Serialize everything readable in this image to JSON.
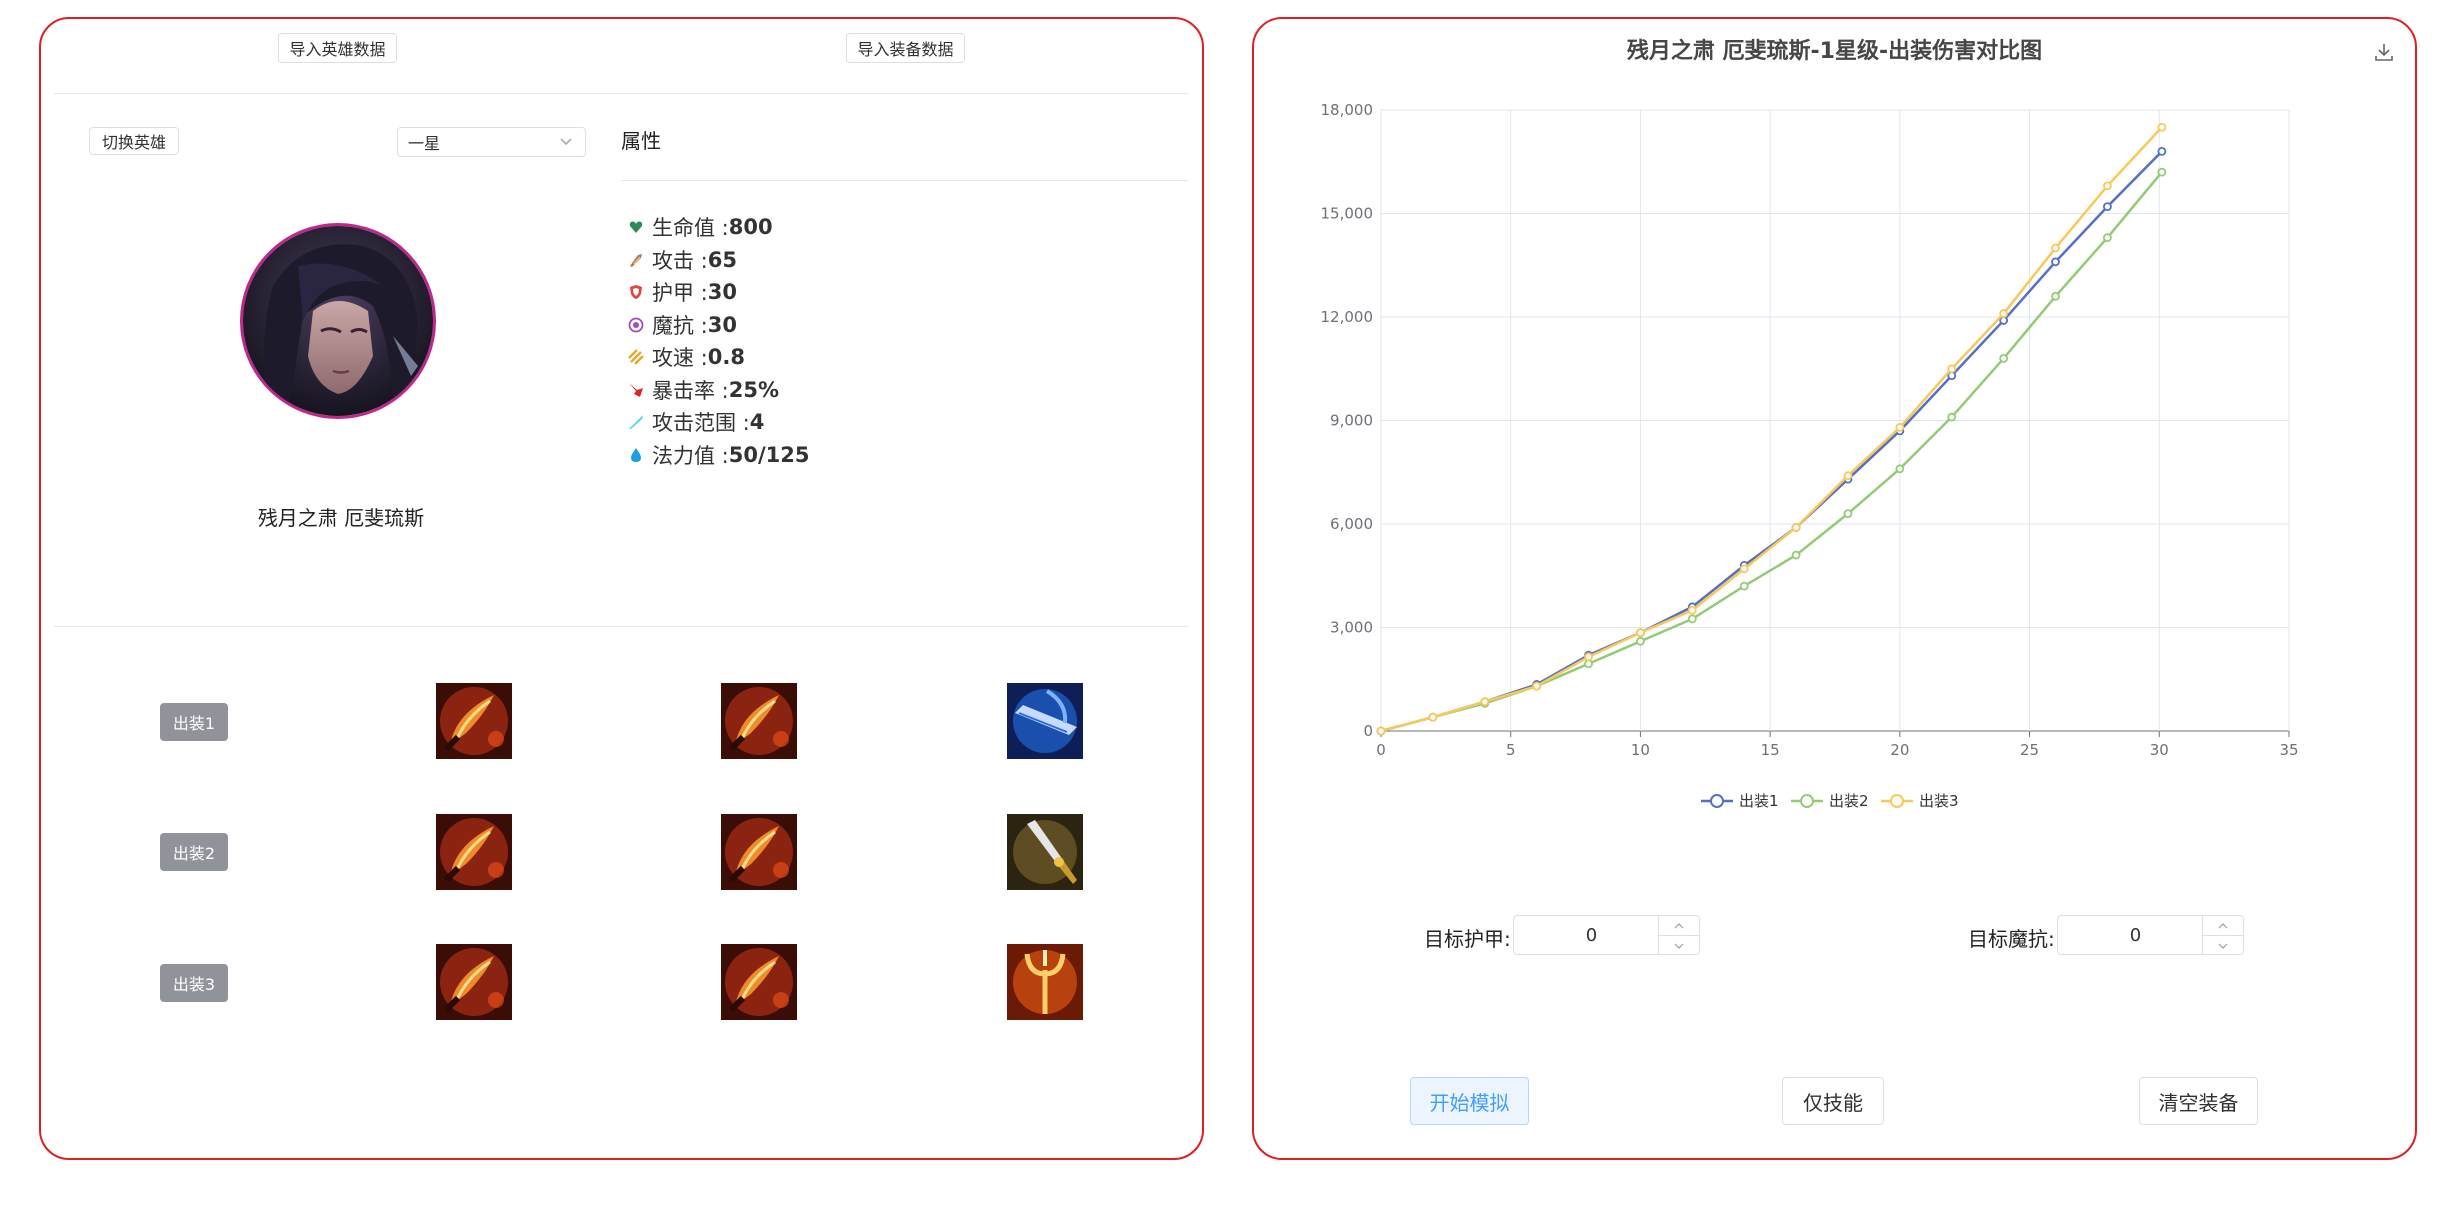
{
  "left": {
    "import_hero_label": "导入英雄数据",
    "import_item_label": "导入装备数据",
    "switch_hero_label": "切换英雄",
    "star_select_value": "一星",
    "hero_name": "残月之肃 厄斐琉斯",
    "attributes_title": "属性",
    "attributes": [
      {
        "label": "生命值 : ",
        "value": "800",
        "icon": "heart-icon",
        "color": "#2e8b57"
      },
      {
        "label": "攻击 : ",
        "value": "65",
        "icon": "attack-icon",
        "color": "#b8764a"
      },
      {
        "label": "护甲 : ",
        "value": "30",
        "icon": "armor-icon",
        "color": "#e0473a"
      },
      {
        "label": "魔抗 : ",
        "value": "30",
        "icon": "magic-resist-icon",
        "color": "#a04bc0"
      },
      {
        "label": "攻速 : ",
        "value": "0.8",
        "icon": "attack-speed-icon",
        "color": "#e8a92c"
      },
      {
        "label": "暴击率 : ",
        "value": "25%",
        "icon": "crit-icon",
        "color": "#d9262c"
      },
      {
        "label": "攻击范围 : ",
        "value": "4",
        "icon": "range-icon",
        "color": "#4fd6e6"
      },
      {
        "label": "法力值 : ",
        "value": "50/125",
        "icon": "mana-icon",
        "color": "#1a9fe0"
      }
    ],
    "builds": [
      {
        "label": "出装1",
        "items": [
          "sword-item-icon",
          "sword-item-icon",
          "blue-blade-item-icon"
        ]
      },
      {
        "label": "出装2",
        "items": [
          "sword-item-icon",
          "sword-item-icon",
          "dagger-item-icon"
        ]
      },
      {
        "label": "出装3",
        "items": [
          "sword-item-icon",
          "sword-item-icon",
          "trident-item-icon"
        ]
      }
    ]
  },
  "right": {
    "chart_title": "残月之肃 厄斐琉斯-1星级-出装伤害对比图",
    "armor_label": "目标护甲:",
    "armor_value": "0",
    "mr_label": "目标魔抗:",
    "mr_value": "0",
    "start_label": "开始模拟",
    "skill_only_label": "仅技能",
    "clear_label": "清空装备"
  },
  "chart_data": {
    "type": "line",
    "title": "残月之肃 厄斐琉斯-1星级-出装伤害对比图",
    "xlabel": "",
    "ylabel": "",
    "xlim": [
      0,
      35
    ],
    "ylim": [
      0,
      18000
    ],
    "xticks": [
      0,
      5,
      10,
      15,
      20,
      25,
      30,
      35
    ],
    "yticks": [
      0,
      3000,
      6000,
      9000,
      12000,
      15000,
      18000
    ],
    "ytick_labels": [
      "0",
      "3,000",
      "6,000",
      "9,000",
      "12,000",
      "15,000",
      "18,000"
    ],
    "grid": true,
    "legend": "bottom-center",
    "series": [
      {
        "name": "出装1",
        "color": "#5470c6",
        "x": [
          0,
          2,
          4,
          6,
          8,
          10,
          12,
          14,
          16,
          18,
          20,
          22,
          24,
          26,
          28,
          30.1
        ],
        "y": [
          0,
          400,
          850,
          1350,
          2200,
          2850,
          3600,
          4800,
          5900,
          7300,
          8700,
          10300,
          11900,
          13600,
          15200,
          16800
        ]
      },
      {
        "name": "出装2",
        "color": "#91cc75",
        "x": [
          0,
          2,
          4,
          6,
          8,
          10,
          12,
          14,
          16,
          18,
          20,
          22,
          24,
          26,
          28,
          30.1
        ],
        "y": [
          0,
          400,
          800,
          1300,
          1950,
          2600,
          3250,
          4200,
          5100,
          6300,
          7600,
          9100,
          10800,
          12600,
          14300,
          16200
        ]
      },
      {
        "name": "出装3",
        "color": "#fac858",
        "x": [
          0,
          2,
          4,
          6,
          8,
          10,
          12,
          14,
          16,
          18,
          20,
          22,
          24,
          26,
          28,
          30.1
        ],
        "y": [
          0,
          400,
          850,
          1300,
          2150,
          2850,
          3500,
          4700,
          5900,
          7400,
          8800,
          10500,
          12100,
          14000,
          15800,
          17500
        ]
      }
    ]
  }
}
